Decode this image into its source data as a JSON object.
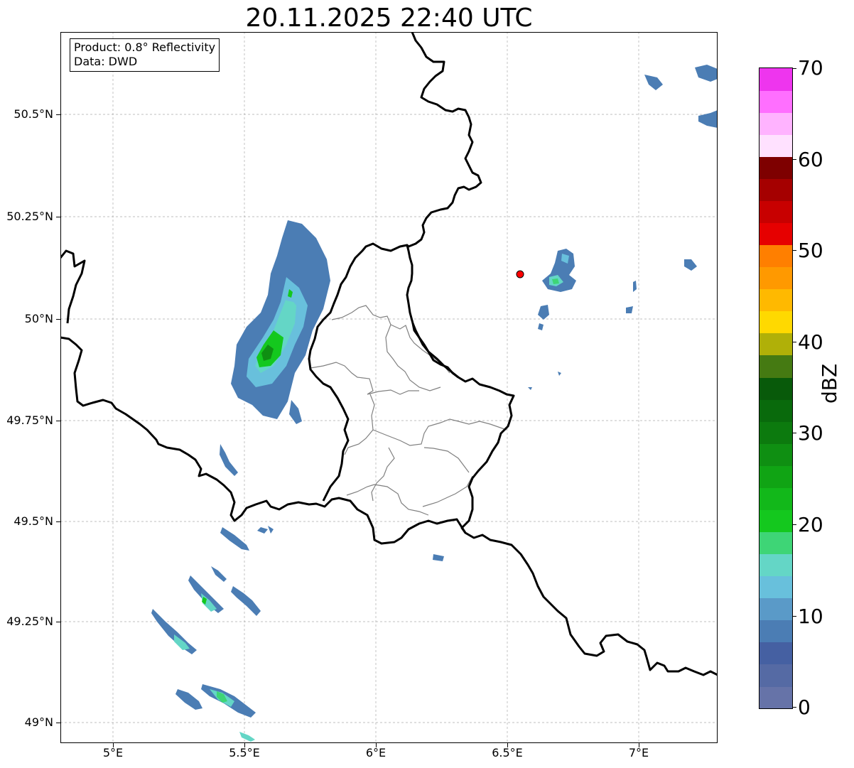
{
  "title": "20.11.2025 22:40 UTC",
  "infobox": {
    "product": "Product: 0.8° Reflectivity",
    "source": "Data: DWD"
  },
  "map": {
    "lon_range": [
      4.8,
      7.3
    ],
    "lat_range": [
      48.95,
      50.72
    ],
    "gridlines": true,
    "x_ticks": [
      "5°E",
      "5.5°E",
      "6°E",
      "6.5°E",
      "7°E"
    ],
    "y_ticks": [
      "49°N",
      "49.25°N",
      "49.5°N",
      "49.75°N",
      "50°N",
      "50.25°N",
      "50.5°N"
    ],
    "radar_site_marker": {
      "lon": 6.55,
      "lat": 50.11,
      "color": "#ff0000"
    }
  },
  "colorbar": {
    "label": "dBZ",
    "ticks": [
      "0",
      "10",
      "20",
      "30",
      "40",
      "50",
      "60",
      "70"
    ],
    "range": [
      0,
      70
    ],
    "colors": [
      "#6673a8",
      "#556aa4",
      "#4560a2",
      "#4b7db4",
      "#5a9ac8",
      "#68c0dc",
      "#64d6c6",
      "#3ed576",
      "#14c81e",
      "#12b81a",
      "#10a414",
      "#0f8f12",
      "#0c7a0e",
      "#096a0c",
      "#085a0a",
      "#457a12",
      "#b0b008",
      "#ffd900",
      "#ffb900",
      "#ff9900",
      "#ff7f00",
      "#e60000",
      "#c80000",
      "#a50000",
      "#7e0000",
      "#ffe1ff",
      "#ffb3ff",
      "#ff6fff",
      "#ee35ee"
    ]
  }
}
